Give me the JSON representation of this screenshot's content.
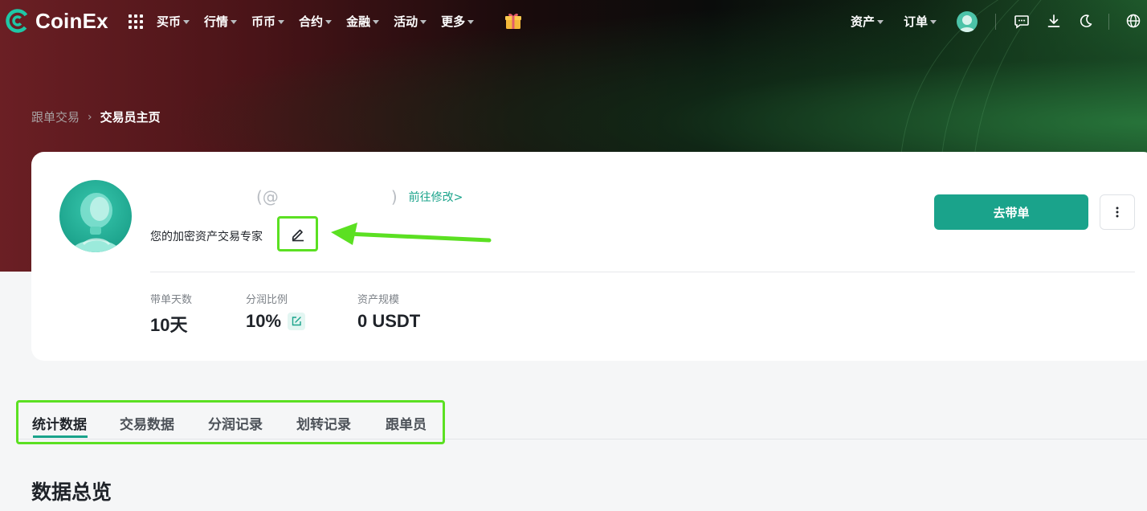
{
  "nav": {
    "brand": "CoinEx",
    "menu": [
      {
        "label": "买币"
      },
      {
        "label": "行情"
      },
      {
        "label": "币币"
      },
      {
        "label": "合约"
      },
      {
        "label": "金融"
      },
      {
        "label": "活动"
      },
      {
        "label": "更多"
      }
    ],
    "assets_label": "资产",
    "orders_label": "订单"
  },
  "breadcrumb": {
    "parent": "跟单交易",
    "current": "交易员主页"
  },
  "profile": {
    "name_open": "(@",
    "name_close": ")",
    "edit_link": "前往修改>",
    "bio": "您的加密资产交易专家",
    "stats": [
      {
        "label": "带单天数",
        "value": "10天"
      },
      {
        "label": "分润比例",
        "value": "10%"
      },
      {
        "label": "资产规模",
        "value": "0 USDT"
      }
    ],
    "lead_button": "去带单"
  },
  "tabs": [
    {
      "label": "统计数据",
      "active": true
    },
    {
      "label": "交易数据",
      "active": false
    },
    {
      "label": "分润记录",
      "active": false
    },
    {
      "label": "划转记录",
      "active": false
    },
    {
      "label": "跟单员",
      "active": false
    }
  ],
  "section": {
    "title": "数据总览"
  },
  "colors": {
    "accent": "#1aa38b",
    "highlight": "#5be022"
  }
}
